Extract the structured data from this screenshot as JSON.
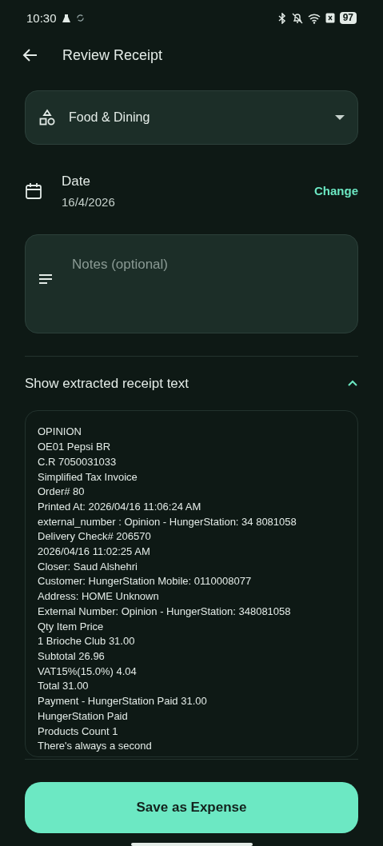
{
  "status_bar": {
    "time": "10:30",
    "battery": "97"
  },
  "app_bar": {
    "title": "Review Receipt"
  },
  "category": {
    "value": "Food & Dining"
  },
  "date": {
    "label": "Date",
    "value": "16/4/2026",
    "action": "Change"
  },
  "notes": {
    "placeholder": "Notes (optional)"
  },
  "extracted": {
    "title": "Show extracted receipt text",
    "expanded": true,
    "lines": [
      "OPINION",
      "OE01 Pepsi BR",
      "C.R 7050031033",
      "Simplified Tax Invoice",
      "Order# 80",
      "Printed At: 2026/04/16 11:06:24 AM",
      "external_number : Opinion - HungerStation: 34 8081058",
      "Delivery Check# 206570",
      "2026/04/16 11:02:25 AM",
      "Closer: Saud Alshehri",
      "Customer: HungerStation Mobile: 0110008077",
      "Address: HOME Unknown",
      "External Number: Opinion - HungerStation: 348081058",
      "Qty Item Price",
      "1 Brioche Club 31.00",
      "Subtotal 26.96",
      "VAT15%(15.0%) 4.04",
      "Total 31.00",
      "Payment - HungerStation Paid 31.00",
      "HungerStation Paid",
      "Products Count 1",
      "There's always a second"
    ]
  },
  "save_button": "Save as Expense"
}
